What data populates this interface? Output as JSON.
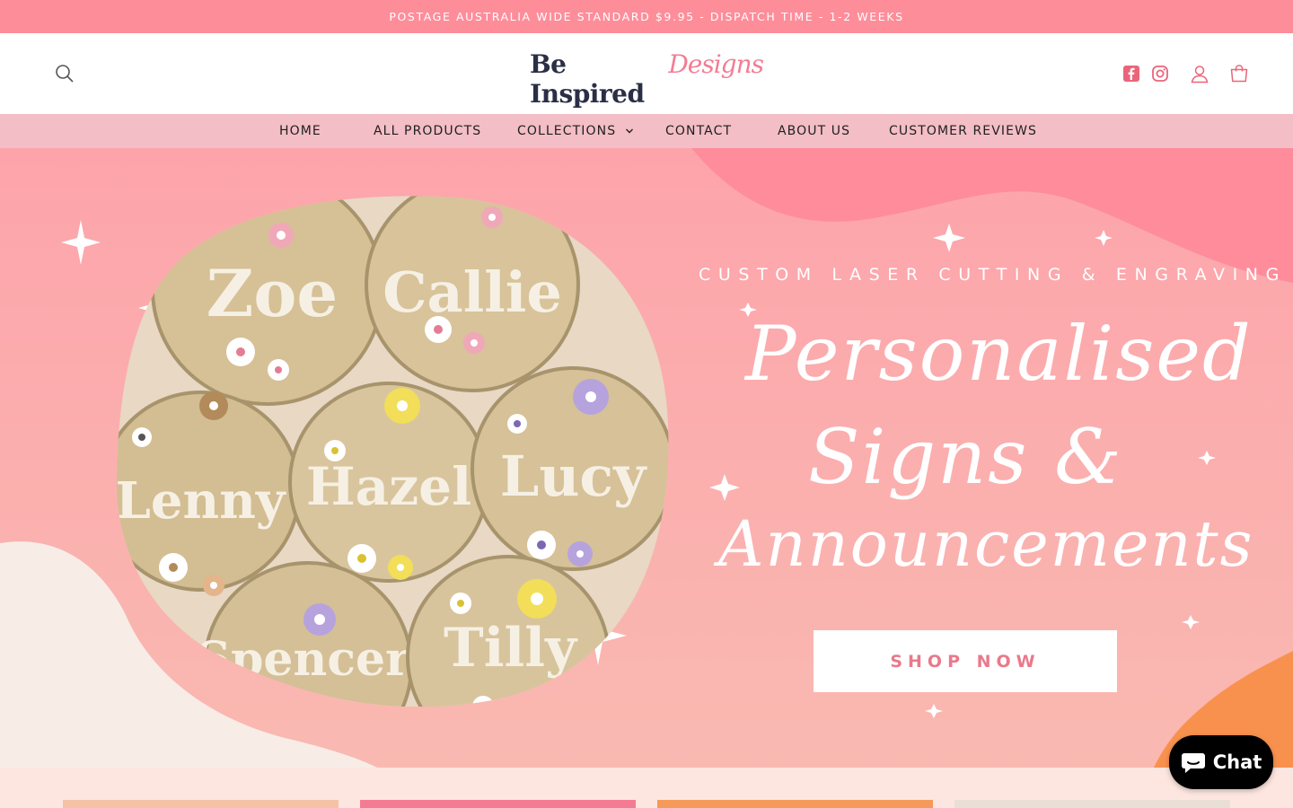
{
  "announcement": "POSTAGE AUSTRALIA WIDE STANDARD $9.95 - DISPATCH TIME - 1-2 WEEKS",
  "header": {
    "logo_main": "Be Inspired",
    "logo_script": "Designs",
    "icons": [
      "search-icon",
      "facebook-icon",
      "instagram-icon",
      "account-icon",
      "cart-icon"
    ]
  },
  "nav": {
    "items": [
      {
        "label": "HOME"
      },
      {
        "label": "ALL PRODUCTS"
      },
      {
        "label": "COLLECTIONS"
      },
      {
        "label": "CONTACT"
      },
      {
        "label": "ABOUT US"
      },
      {
        "label": "CUSTOMER REVIEWS"
      }
    ]
  },
  "hero": {
    "plaques": [
      "Zoe",
      "Callie",
      "Lenny",
      "Hazel",
      "Lucy",
      "Spencer",
      "Tilly"
    ],
    "tagline": "CUSTOM LASER CUTTING & ENGRAVING",
    "script_lines": [
      "Personalised",
      "Signs &",
      "Announcements"
    ],
    "cta": "SHOP NOW"
  },
  "chat": {
    "label": "Chat"
  },
  "colors": {
    "announcement_bg": "#fe8d9a",
    "nav_bg": "#f3bec5",
    "hero_pink": "#fca8ad",
    "hero_orange": "#f9914e",
    "cta_text": "#e9798b",
    "chat_bg": "#000000"
  }
}
